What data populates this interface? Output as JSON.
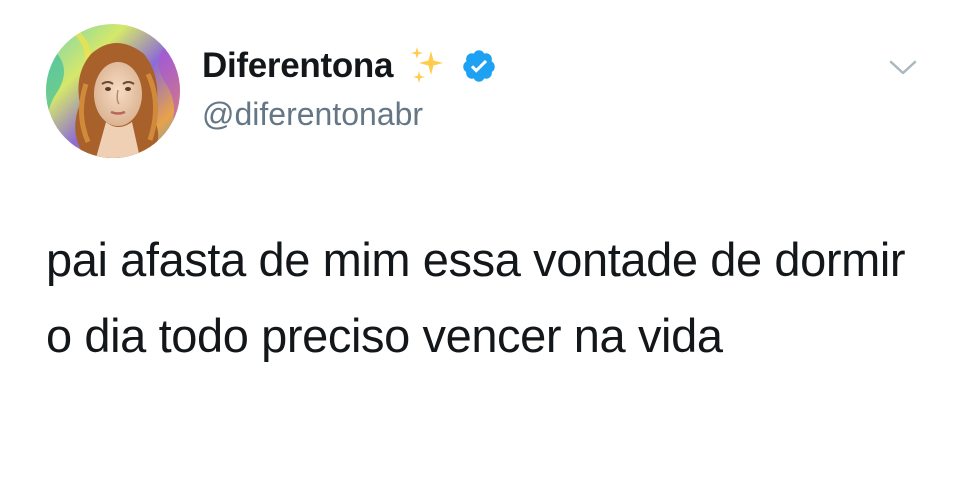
{
  "tweet": {
    "author": {
      "display_name": "Diferentona",
      "handle": "@diferentonabr",
      "verified": true,
      "name_emoji": "sparkles-icon",
      "avatar": "avatar-renaissance-portrait-psychedelic"
    },
    "text": "pai afasta de mim essa vontade de dormir o dia todo preciso vencer na vida",
    "menu_icon": "chevron-down-icon"
  },
  "colors": {
    "text": "#14171a",
    "handle": "#657786",
    "verified_badge": "#1da1f2",
    "sparkle": "#ffcc4d",
    "caret": "#aab8c2"
  }
}
